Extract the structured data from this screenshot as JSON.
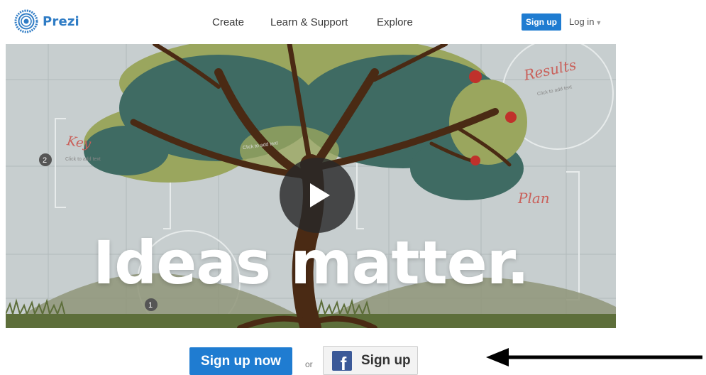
{
  "header": {
    "logo_text": "Prezi",
    "nav": [
      "Create",
      "Learn & Support",
      "Explore"
    ],
    "signup_label": "Sign up",
    "login_label": "Log in"
  },
  "hero": {
    "headline": "Ideas matter.",
    "board_labels": {
      "results": "Results",
      "key": "Key",
      "plan": "Plan",
      "click_to_add": "Click to add text",
      "num_2": "2",
      "num_1": "1"
    }
  },
  "cta": {
    "primary_label": "Sign up now",
    "or_text": "or",
    "facebook_label": "Sign up",
    "facebook_icon_letter": "f"
  },
  "colors": {
    "brand_blue": "#1f7cd1",
    "logo_blue": "#2f7cc5",
    "facebook_blue": "#3b5998",
    "canvas_gray": "#c7cecf",
    "foliage_dark": "#3f6b63",
    "foliage_light": "#9aa65e",
    "trunk": "#4a2a14",
    "apple_red": "#c0312b",
    "label_red": "#c9605a"
  }
}
